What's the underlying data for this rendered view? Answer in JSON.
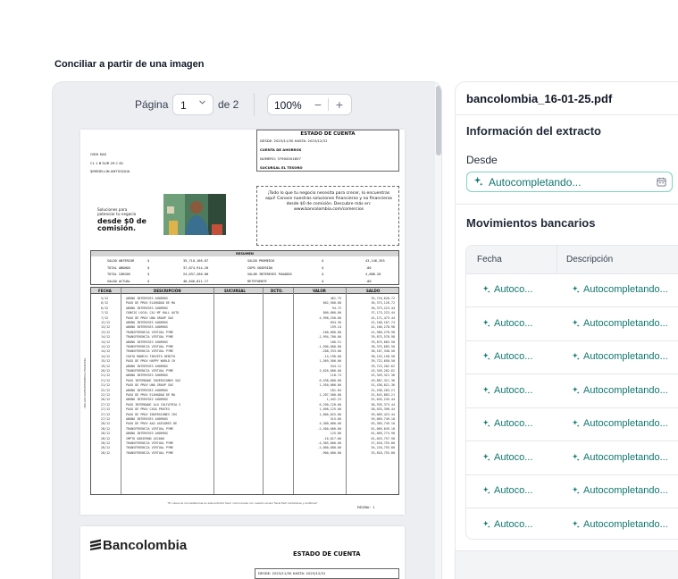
{
  "page": {
    "heading": "Conciliar a partir de una imagen"
  },
  "viewer": {
    "page_label": "Página",
    "page_value": "1",
    "page_of": "de 2",
    "zoom_value": "100%",
    "zoom_out": "−",
    "zoom_in": "+"
  },
  "statement": {
    "title": "ESTADO DE CUENTA",
    "period": "DESDE:  2023/11/30          HASTA:   2023/12/31",
    "account_type": "CUENTA DE AHORROS",
    "number": "NÚMERO:         37900001857",
    "branch": "SUCURSAL EL TESORO",
    "client_name": "OSHI SAS",
    "client_address": "CL 1 B SUR 29 C 81",
    "client_city": "$MEDELLIN ANTIOQUIA",
    "promo_small": "Soluciones para potenciar tu negocio",
    "promo_big": "desde $0 de comisión.",
    "promo_box": "¡Todo lo que tu negocio necesita para crecer, lo encuentras aquí! Conoce nuestras soluciones financieras y no financieras desde $0 de comisión.  Descubre más en: www.bancolombia.com/comercios",
    "resumen_title": "RESUMEN",
    "resumen": [
      [
        "SALDO ANTERIOR",
        "$",
        "35,710,166.87",
        "SALDO PROMEDIO",
        "$",
        "43,146,355"
      ],
      [
        "TOTAL ABONOS",
        "$",
        "37,074,914.20",
        "CUPO SUGERIDO",
        "$",
        ".00"
      ],
      [
        "TOTAL CARGOS",
        "$",
        "24,637,266.00",
        "VALOR INTERESES PAGADOS",
        "$",
        "4,688.20"
      ],
      [
        "SALDO ACTUAL",
        "$",
        "46,646,811.17",
        "RETEFUENTE",
        "$",
        ".00"
      ]
    ],
    "columns": [
      "FECHA",
      "DESCRIPCIÓN",
      "SUCURSAL",
      "DCTO.",
      "VALOR",
      "SALDO"
    ],
    "rows": [
      [
        "5/12",
        "ABONO INTERESES AHORROS",
        "461.75",
        "35,710,628.72"
      ],
      [
        "6/12",
        "PAGO DE PROV ELOHADAD DE MA",
        "662,500.00",
        "36,373,128.72"
      ],
      [
        "6/12",
        "ABONO INTERESES AHORROS",
        "94.72",
        "36,373,223.44"
      ],
      [
        "7/12",
        "CONSIG LOCAL CAJ MF HALL AUTO",
        "800,000.00",
        "37,173,223.44"
      ],
      [
        "7/12",
        "PAGO DE PROV UNA GROUP SAS",
        "4,998,250.00",
        "42,171,473.44"
      ],
      [
        "12/12",
        "ABONO INTERESES AHORROS",
        "694.30",
        "42,160,167.74"
      ],
      [
        "13/12",
        "ABONO INTERESES AHORROS",
        "159.24",
        "42,160,278.98"
      ],
      [
        "13/12",
        "TRANSFERENCIA VIRTUAL PYME",
        "-100,000.00",
        "41,960,278.98"
      ],
      [
        "14/12",
        "TRANSFERENCIA VIRTUAL PYME",
        "-1,994,700.00",
        "39,875,578.98"
      ],
      [
        "14/12",
        "ABONO INTERESES AHORROS",
        "106.51",
        "39,875,685.50"
      ],
      [
        "14/12",
        "TRANSFERENCIA VIRTUAL PYME",
        "-1,500,000.00",
        "38,375,685.50"
      ],
      [
        "14/12",
        "TRANSFERENCIA VIRTUAL PYME",
        "-208,333.00",
        "38,167,348.50"
      ],
      [
        "14/12",
        "CUOTA MANEJO TARJETA DEBITO",
        "-14,190.00",
        "38,153,158.50"
      ],
      [
        "15/12",
        "PAGO DE PROV HAPPY WORLD CH",
        "1,569,500.00",
        "39,722,658.50"
      ],
      [
        "19/12",
        "ABONO INTERESES AHORROS",
        "544.12",
        "39,723,202.62"
      ],
      [
        "20/12",
        "TRANSFERENCIA VIRTUAL PYME",
        "3,626,000.00",
        "43,349,202.62"
      ],
      [
        "21/12",
        "ABONO INTERESES AHORROS",
        "118.74",
        "43,349,321.36"
      ],
      [
        "21/12",
        "PAGO INTERBANC INVERSIONES SAS",
        "6,538,000.00",
        "49,887,321.36"
      ],
      [
        "21/12",
        "PAGO DE PROV UNA GROUP SAS",
        "1,550,000.00",
        "51,436,021.36"
      ],
      [
        "22/12",
        "ABONO INTERESES AHORROS",
        "181.84",
        "51,436,203.21"
      ],
      [
        "22/12",
        "PAGO DE PROV ELOHADAD DE MA",
        "1,207,500.00",
        "52,643,803.21"
      ],
      [
        "26/12",
        "ABONO INTERESES AHORROS",
        "1,442.23",
        "52,645,245.44"
      ],
      [
        "27/12",
        "PAGO INTERBANC ALO COLFATRIA S",
        "6,290,128.00",
        "58,935,373.44"
      ],
      [
        "27/12",
        "PAGO DE PROV CASA PRUTEX",
        "1,098,125.00",
        "58,033,398.44"
      ],
      [
        "27/12",
        "PAGO DE PROV INVERSIONES CHS",
        "1,066,025.00",
        "59,069,423.44"
      ],
      [
        "27/12",
        "ABONO INTERESES AHORROS",
        "315.66",
        "59,069,749.10"
      ],
      [
        "28/12",
        "PAGO DE PROV A&G ASESORES DE",
        "4,300,000.00",
        "63,369,749.10"
      ],
      [
        "28/12",
        "TRANSFERENCIA VIRTUAL PYME",
        "-2,400,000.00",
        "61,069,649.10"
      ],
      [
        "28/12",
        "ABONO INTERESES AHORROS",
        "125.80",
        "61,069,774.90"
      ],
      [
        "28/12",
        "IMPTO GOBIERNO 4X1000",
        "-16,017.00",
        "61,053,757.90"
      ],
      [
        "28/12",
        "TRANSFERENCIA VIRTUAL PYME",
        "-4,385,000.00",
        "57,018,755.80"
      ],
      [
        "28/12",
        "TRANSFERENCIA VIRTUAL PYME",
        "-2,000,000.00",
        "54,218,755.80"
      ],
      [
        "28/12",
        "TRANSFERENCIA VIRTUAL PYME",
        "-900,000.00",
        "53,818,755.80"
      ]
    ],
    "footnote": "\"En casos de inconsistencias en este extracto favor comunicarse con nuestro revisor fiscal PwC Contadores y Auditores\"",
    "page_footer": "PÁGINA:  1",
    "side_label": "VIGILADO SUPERINTENDENCIA FINANCIERA",
    "page2_logo": "Bancolombia",
    "page2_title": "ESTADO DE CUENTA",
    "page2_period": "DESDE:  2023/11/30          HASTA:   2023/12/31"
  },
  "panel": {
    "filename": "bancolombia_16-01-25.pdf",
    "extract_info_title": "Información del extracto",
    "from_label": "Desde",
    "from_value": "Autocompletando...",
    "movements_title": "Movimientos bancarios",
    "columns": [
      "Fecha",
      "Descripción"
    ],
    "rows": [
      [
        "Autoco...",
        "Autocompletando..."
      ],
      [
        "Autoco...",
        "Autocompletando..."
      ],
      [
        "Autoco...",
        "Autocompletando..."
      ],
      [
        "Autoco...",
        "Autocompletando..."
      ],
      [
        "Autoco...",
        "Autocompletando..."
      ],
      [
        "Autoco...",
        "Autocompletando..."
      ],
      [
        "Autoco...",
        "Autocompletando..."
      ],
      [
        "Autoco...",
        "Autocompletando..."
      ]
    ]
  },
  "colors": {
    "accent": "#0f766e",
    "accent_border": "#7dd3c0",
    "viewer_bg": "#eceef1"
  },
  "icons": [
    "chevron-down-icon",
    "sparkle-icon",
    "calendar-icon"
  ]
}
